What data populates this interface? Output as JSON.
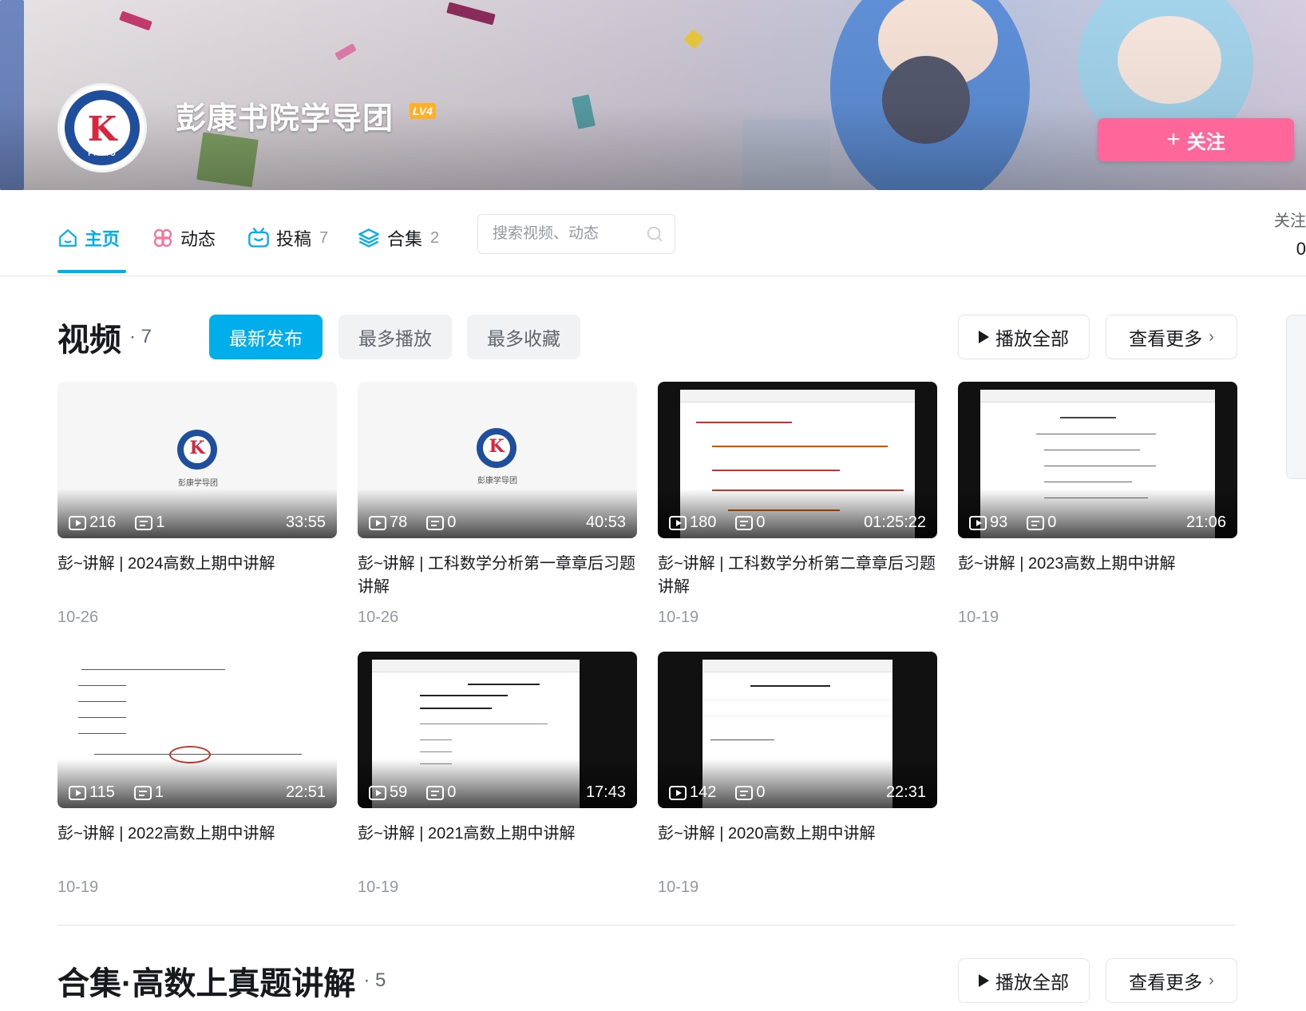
{
  "profile": {
    "name": "彭康书院学导团",
    "level": "LV4",
    "follow_label": "关注",
    "avatar_mark": "K",
    "avatar_caption": "PKSTU"
  },
  "nav": {
    "tabs": [
      {
        "label": "主页",
        "icon": "home-icon",
        "count": ""
      },
      {
        "label": "动态",
        "icon": "pinwheel-icon",
        "count": ""
      },
      {
        "label": "投稿",
        "icon": "tv-icon",
        "count": "7"
      },
      {
        "label": "合集",
        "icon": "layers-icon",
        "count": "2"
      }
    ],
    "search_placeholder": "搜索视频、动态",
    "following_label": "关注",
    "following_count": "0"
  },
  "videos_section": {
    "title": "视频",
    "count": "7",
    "sort_options": [
      "最新发布",
      "最多播放",
      "最多收藏"
    ],
    "play_all": "播放全部",
    "see_more": "查看更多"
  },
  "videos": [
    {
      "title": "彭~讲解 | 2024高数上期中讲解",
      "plays": "216",
      "danmaku": "1",
      "duration": "33:55",
      "date": "10-26",
      "thumb": "logo",
      "thumb_caption": "彭康学导团"
    },
    {
      "title": "彭~讲解 | 工科数学分析第一章章后习题讲解",
      "plays": "78",
      "danmaku": "0",
      "duration": "40:53",
      "date": "10-26",
      "thumb": "logo",
      "thumb_caption": "彭康学导团"
    },
    {
      "title": "彭~讲解 | 工科数学分析第二章章后习题讲解",
      "plays": "180",
      "danmaku": "0",
      "duration": "01:25:22",
      "date": "10-19",
      "thumb": "screen"
    },
    {
      "title": "彭~讲解 | 2023高数上期中讲解",
      "plays": "93",
      "danmaku": "0",
      "duration": "21:06",
      "date": "10-19",
      "thumb": "screen"
    },
    {
      "title": "彭~讲解 | 2022高数上期中讲解",
      "plays": "115",
      "danmaku": "1",
      "duration": "22:51",
      "date": "10-19",
      "thumb": "doc"
    },
    {
      "title": "彭~讲解 | 2021高数上期中讲解",
      "plays": "59",
      "danmaku": "0",
      "duration": "17:43",
      "date": "10-19",
      "thumb": "screen"
    },
    {
      "title": "彭~讲解 | 2020高数上期中讲解",
      "plays": "142",
      "danmaku": "0",
      "duration": "22:31",
      "date": "10-19",
      "thumb": "screen"
    }
  ],
  "collection_section": {
    "title": "合集·高数上真题讲解",
    "count": "5",
    "play_all": "播放全部",
    "see_more": "查看更多"
  },
  "colors": {
    "accent": "#00aeec",
    "follow_pink": "#ff6699",
    "level_badge": "#ffb027",
    "muted_text": "#9499a0"
  }
}
